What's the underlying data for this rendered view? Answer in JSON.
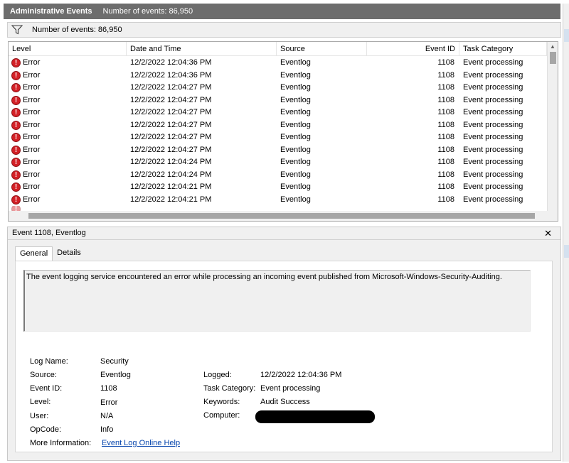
{
  "window": {
    "title": "Administrative Events",
    "event_count": "Number of events: 86,950"
  },
  "filter": {
    "icon": "funnel-icon",
    "text": "Number of events: 86,950"
  },
  "grid": {
    "columns": [
      "Level",
      "Date and Time",
      "Source",
      "Event ID",
      "Task Category"
    ],
    "rows": [
      {
        "level": "Error",
        "date": "12/2/2022 12:04:36 PM",
        "source": "Eventlog",
        "id": "1108",
        "category": "Event processing"
      },
      {
        "level": "Error",
        "date": "12/2/2022 12:04:36 PM",
        "source": "Eventlog",
        "id": "1108",
        "category": "Event processing"
      },
      {
        "level": "Error",
        "date": "12/2/2022 12:04:27 PM",
        "source": "Eventlog",
        "id": "1108",
        "category": "Event processing"
      },
      {
        "level": "Error",
        "date": "12/2/2022 12:04:27 PM",
        "source": "Eventlog",
        "id": "1108",
        "category": "Event processing"
      },
      {
        "level": "Error",
        "date": "12/2/2022 12:04:27 PM",
        "source": "Eventlog",
        "id": "1108",
        "category": "Event processing"
      },
      {
        "level": "Error",
        "date": "12/2/2022 12:04:27 PM",
        "source": "Eventlog",
        "id": "1108",
        "category": "Event processing"
      },
      {
        "level": "Error",
        "date": "12/2/2022 12:04:27 PM",
        "source": "Eventlog",
        "id": "1108",
        "category": "Event processing"
      },
      {
        "level": "Error",
        "date": "12/2/2022 12:04:27 PM",
        "source": "Eventlog",
        "id": "1108",
        "category": "Event processing"
      },
      {
        "level": "Error",
        "date": "12/2/2022 12:04:24 PM",
        "source": "Eventlog",
        "id": "1108",
        "category": "Event processing"
      },
      {
        "level": "Error",
        "date": "12/2/2022 12:04:24 PM",
        "source": "Eventlog",
        "id": "1108",
        "category": "Event processing"
      },
      {
        "level": "Error",
        "date": "12/2/2022 12:04:21 PM",
        "source": "Eventlog",
        "id": "1108",
        "category": "Event processing"
      },
      {
        "level": "Error",
        "date": "12/2/2022 12:04:21 PM",
        "source": "Eventlog",
        "id": "1108",
        "category": "Event processing"
      }
    ],
    "error_icon": "error-icon",
    "error_color": "#d32026"
  },
  "details": {
    "title": "Event 1108, Eventlog",
    "tabs": [
      "General",
      "Details"
    ],
    "active_tab": "General",
    "message": "The event logging service encountered an error while processing an incoming event published from Microsoft-Windows-Security-Auditing.",
    "labels": {
      "log_name": "Log Name:",
      "source": "Source:",
      "event_id": "Event ID:",
      "level": "Level:",
      "user": "User:",
      "opcode": "OpCode:",
      "more_info": "More Information:",
      "logged": "Logged:",
      "task_category": "Task Category:",
      "keywords": "Keywords:",
      "computer": "Computer:"
    },
    "values": {
      "log_name": "Security",
      "source": "Eventlog",
      "event_id": "1108",
      "level": "Error",
      "user": "N/A",
      "opcode": "Info",
      "more_info": "Event Log Online Help",
      "logged": "12/2/2022 12:04:36 PM",
      "task_category": "Event processing",
      "keywords": "Audit Success",
      "computer": ""
    }
  },
  "colors": {
    "titlebar": "#6d6d6d",
    "link": "#0645ad",
    "panel": "#f0f0f0"
  }
}
